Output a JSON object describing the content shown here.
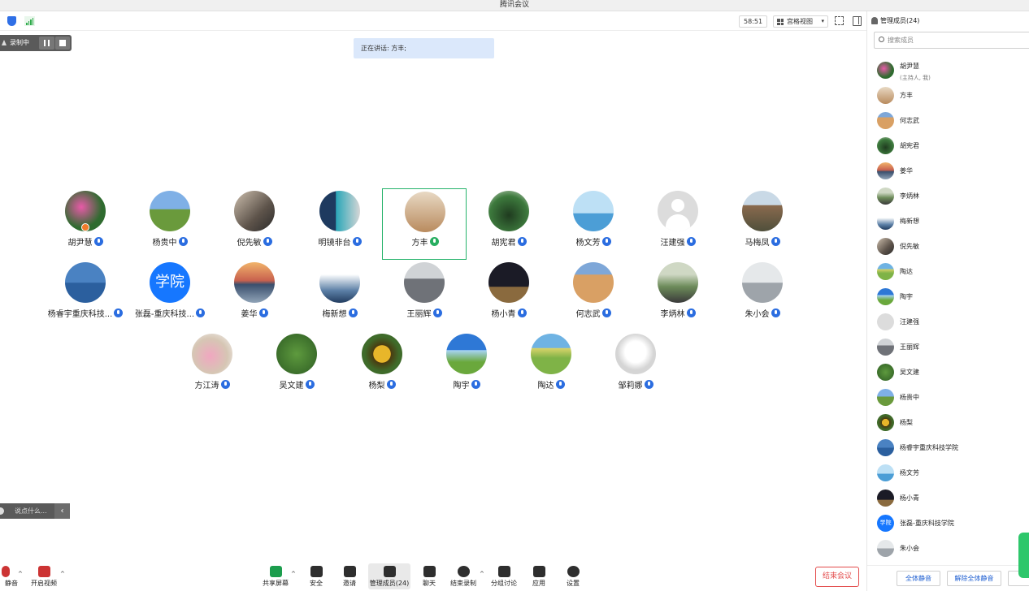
{
  "window": {
    "title": "腾讯会议"
  },
  "topbar": {
    "timer": "58:51",
    "view_label": "宫格视图"
  },
  "recording": {
    "label": "录制中"
  },
  "speaking": {
    "text": "正在讲话: 方丰;"
  },
  "participants": [
    {
      "name": "胡尹慧",
      "mic": "on"
    },
    {
      "name": "杨贵中",
      "mic": "on"
    },
    {
      "name": "倪先敏",
      "mic": "on"
    },
    {
      "name": "明镜非台",
      "mic": "on"
    },
    {
      "name": "方丰",
      "mic": "speaking"
    },
    {
      "name": "胡宪君",
      "mic": "on"
    },
    {
      "name": "杨文芳",
      "mic": "on"
    },
    {
      "name": "汪建强",
      "mic": "on"
    },
    {
      "name": "马梅凤",
      "mic": "on"
    },
    {
      "name": "杨睿宇重庆科技...",
      "mic": "on"
    },
    {
      "name": "张磊-重庆科技...",
      "mic": "on",
      "avatar_text": "学院"
    },
    {
      "name": "姜华",
      "mic": "on"
    },
    {
      "name": "梅新想",
      "mic": "on"
    },
    {
      "name": "王丽辉",
      "mic": "on"
    },
    {
      "name": "杨小青",
      "mic": "on"
    },
    {
      "name": "何志武",
      "mic": "on"
    },
    {
      "name": "李炳林",
      "mic": "on"
    },
    {
      "name": "朱小会",
      "mic": "on"
    },
    {
      "name": "方江涛",
      "mic": "on"
    },
    {
      "name": "吴文建",
      "mic": "on"
    },
    {
      "name": "杨梨",
      "mic": "on"
    },
    {
      "name": "陶宇",
      "mic": "on"
    },
    {
      "name": "陶达",
      "mic": "on"
    },
    {
      "name": "邹莉娜",
      "mic": "on"
    }
  ],
  "chat": {
    "placeholder": "说点什么..."
  },
  "toolbar": {
    "mute_label": "静音",
    "video_label": "开启视频",
    "share_label": "共享屏幕",
    "security_label": "安全",
    "invite_label": "邀请",
    "members_label": "管理成员(24)",
    "chat_label": "聊天",
    "record_label": "结束录制",
    "breakout_label": "分组讨论",
    "apps_label": "应用",
    "settings_label": "设置",
    "end_label": "结束会议"
  },
  "sidebar": {
    "title": "管理成员(24)",
    "search_placeholder": "搜索成员",
    "members": [
      {
        "name": "胡尹慧",
        "role": "(主持人, 我)"
      },
      {
        "name": "方丰"
      },
      {
        "name": "何志武"
      },
      {
        "name": "胡宪君"
      },
      {
        "name": "姜华"
      },
      {
        "name": "李炳林"
      },
      {
        "name": "梅新想"
      },
      {
        "name": "倪先敏"
      },
      {
        "name": "陶达"
      },
      {
        "name": "陶宇"
      },
      {
        "name": "汪建强"
      },
      {
        "name": "王丽辉"
      },
      {
        "name": "吴文建"
      },
      {
        "name": "杨贵中"
      },
      {
        "name": "杨梨"
      },
      {
        "name": "杨睿宇重庆科技学院"
      },
      {
        "name": "杨文芳"
      },
      {
        "name": "杨小青"
      },
      {
        "name": "张磊-重庆科技学院",
        "avatar_text": "学院"
      },
      {
        "name": "朱小会"
      }
    ],
    "mute_all_label": "全体静音",
    "unmute_all_label": "解除全体静音"
  },
  "colors": {
    "accent": "#1677ff",
    "speaking_border": "#26b36b",
    "end_meeting": "#e34b4b"
  }
}
